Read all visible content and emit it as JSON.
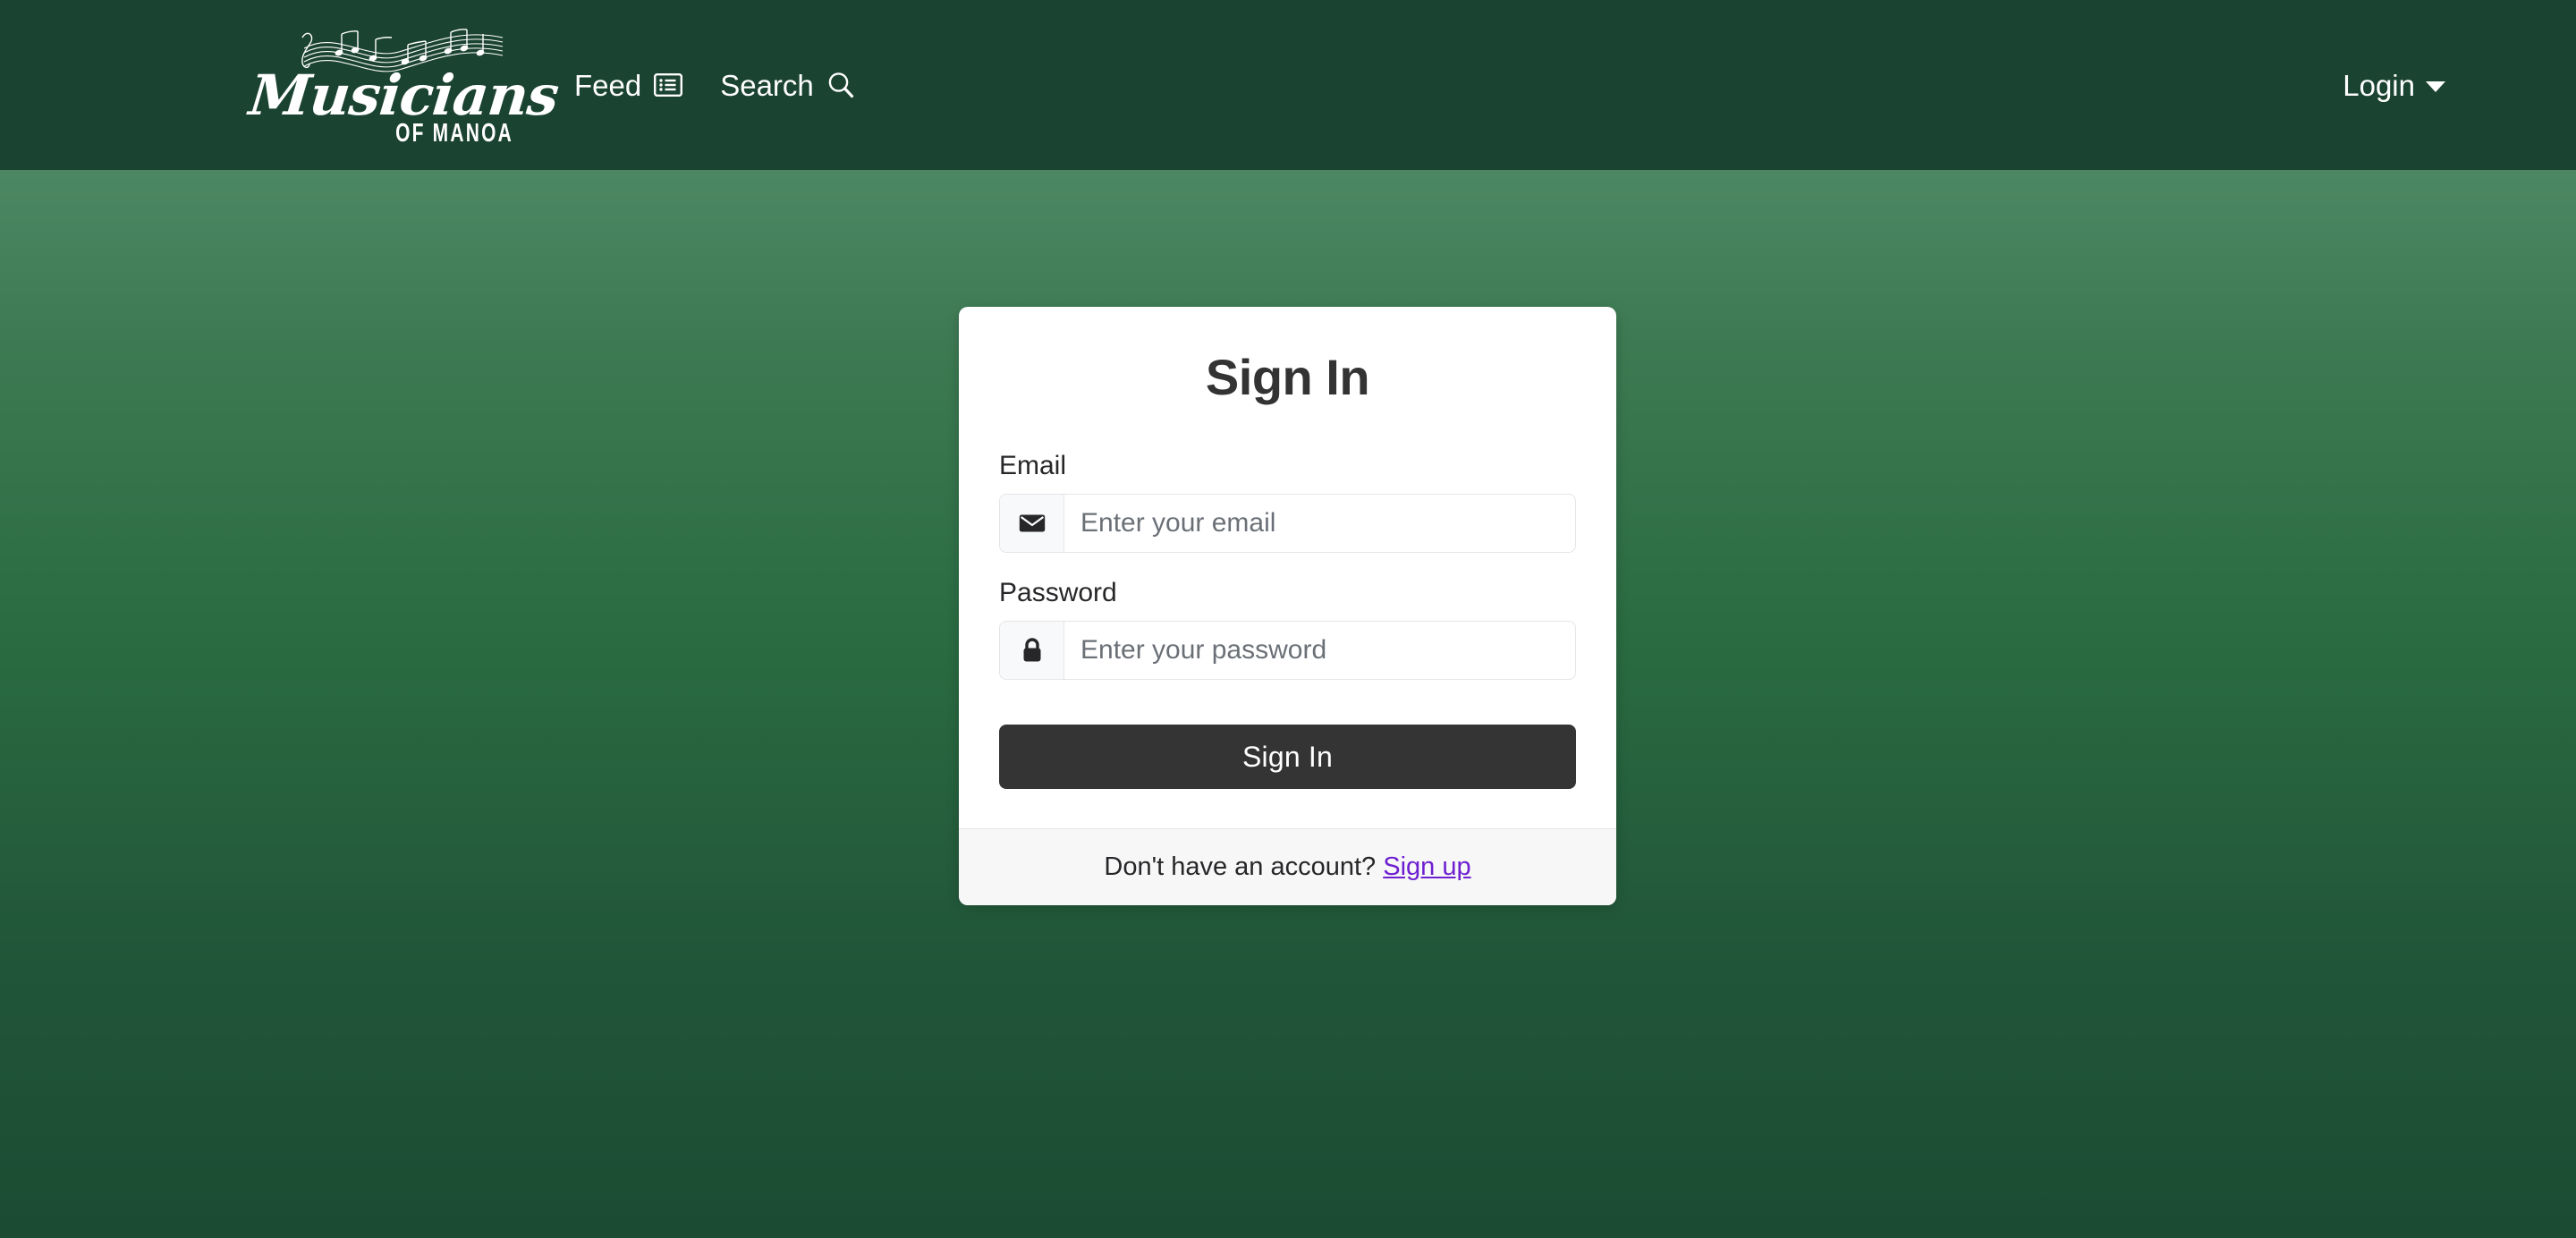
{
  "navbar": {
    "brand": {
      "name": "musicians-of-manoa-logo",
      "word": "Musicians",
      "subtitle": "OF MANOA",
      "icon": "music-staff-notes-icon"
    },
    "links": [
      {
        "label": "Feed",
        "icon": "list-feed-icon"
      },
      {
        "label": "Search",
        "icon": "search-icon"
      }
    ],
    "right": {
      "login_label": "Login",
      "caret_icon": "chevron-down-icon"
    },
    "background_color": "#1b4332"
  },
  "background": {
    "gradient_top": "#5a9472",
    "gradient_bottom": "#1b4c33"
  },
  "card": {
    "title": "Sign In",
    "fields": [
      {
        "label": "Email",
        "icon": "envelope-icon",
        "placeholder": "Enter your email",
        "value": ""
      },
      {
        "label": "Password",
        "icon": "lock-icon",
        "placeholder": "Enter your password",
        "value": ""
      }
    ],
    "submit_label": "Sign In",
    "submit_color": "#343434",
    "footer": {
      "prompt": "Don't have an account?",
      "link_label": "Sign up",
      "link_color": "#6f20d0"
    }
  }
}
